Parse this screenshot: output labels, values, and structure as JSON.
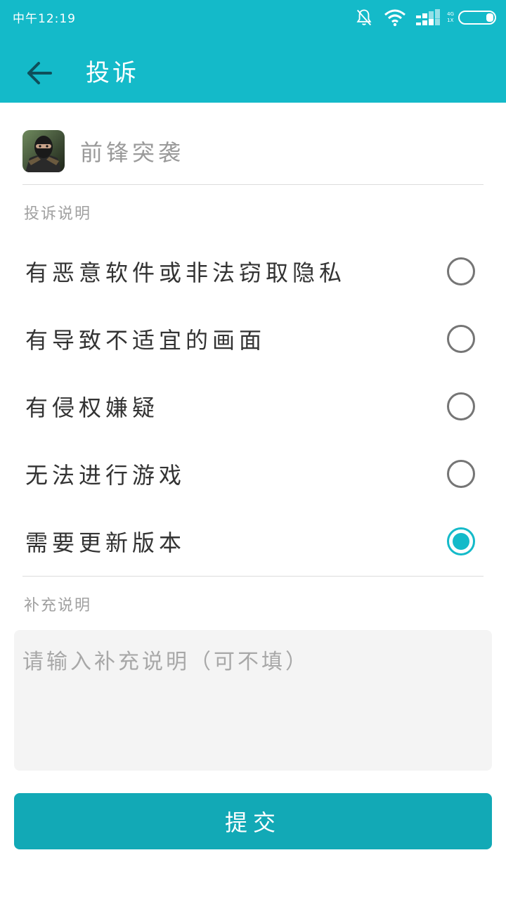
{
  "status_bar": {
    "time": "中午12:19",
    "icons": [
      "bell-off-icon",
      "wifi-icon",
      "signal-icon",
      "battery-icon"
    ],
    "net_top": "4G",
    "net_bottom": "1X"
  },
  "app_bar": {
    "title": "投诉",
    "back_icon": "arrow-left-icon"
  },
  "game": {
    "name": "前锋突袭"
  },
  "reason_section": {
    "label": "投诉说明"
  },
  "options": [
    {
      "label": "有恶意软件或非法窃取隐私",
      "selected": false
    },
    {
      "label": "有导致不适宜的画面",
      "selected": false
    },
    {
      "label": "有侵权嫌疑",
      "selected": false
    },
    {
      "label": "无法进行游戏",
      "selected": false
    },
    {
      "label": "需要更新版本",
      "selected": true
    }
  ],
  "extra_section": {
    "label": "补充说明",
    "placeholder": "请输入补充说明（可不填）"
  },
  "submit_label": "提交",
  "colors": {
    "primary": "#14bac9",
    "button": "#12a9b6",
    "divider": "#dcdcdc",
    "field_bg": "#f4f4f4"
  }
}
